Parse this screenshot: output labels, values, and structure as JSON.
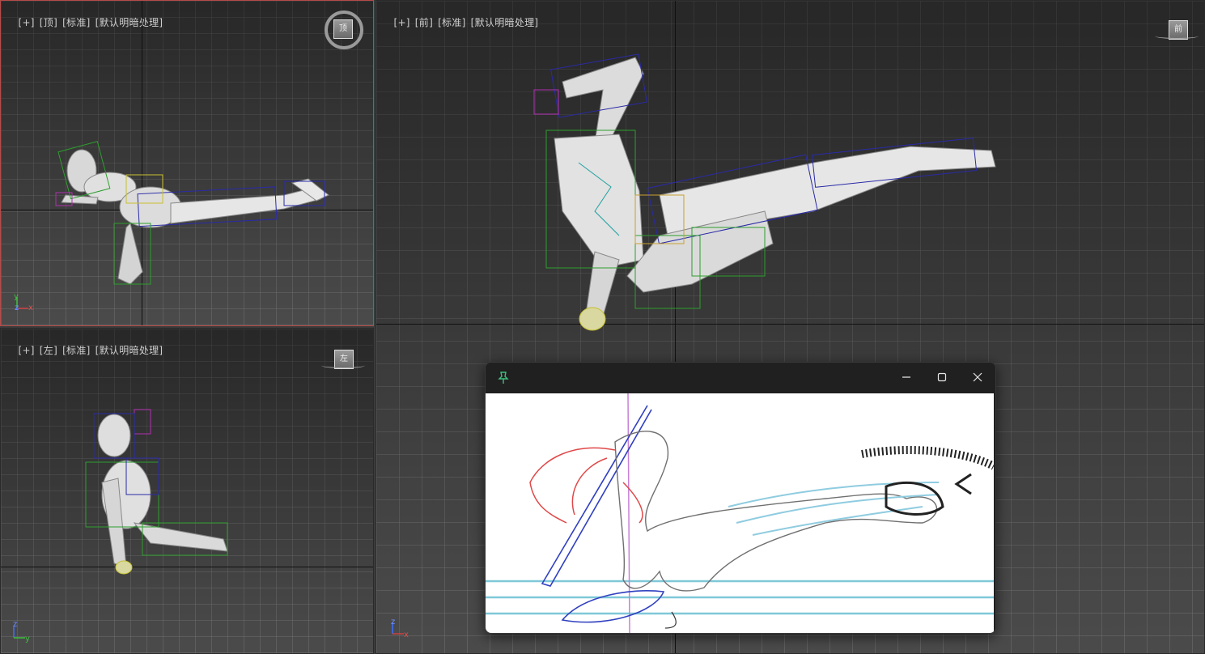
{
  "viewports": {
    "top": {
      "label": [
        "[+]",
        "[顶]",
        "[标准]",
        "[默认明暗处理]"
      ],
      "viewcube": "顶"
    },
    "left": {
      "label": [
        "[+]",
        "[左]",
        "[标准]",
        "[默认明暗处理]"
      ],
      "viewcube": "左"
    },
    "front": {
      "label": [
        "[+]",
        "[前]",
        "[标准]",
        "[默认明暗处理]"
      ],
      "viewcube": "前"
    }
  },
  "axes": {
    "x": "x",
    "y": "y",
    "z": "z"
  },
  "colors": {
    "active_border": "#b54a4a",
    "rig_blue": "#2a2aa8",
    "rig_green": "#2e9e2e",
    "rig_magenta": "#b030b0",
    "rig_yellow": "#c8c030",
    "sketch_red": "#e04848",
    "sketch_cyan": "#7fc8d8"
  },
  "reference_window": {
    "pin_icon": "pin-icon",
    "minimize_icon": "minimize-icon",
    "maximize_icon": "maximize-icon",
    "close_icon": "close-icon"
  }
}
